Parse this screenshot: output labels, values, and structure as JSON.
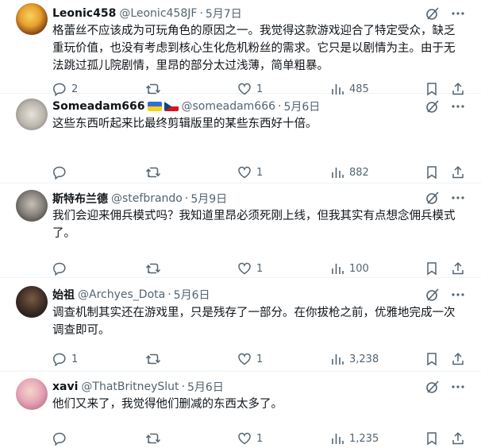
{
  "tweets": [
    {
      "display_name": "Leonic458",
      "handle": "@Leonic458JF",
      "time": "5月7日",
      "text": "格蕾丝不应该成为可玩角色的原因之一。我觉得这款游戏迎合了特定受众，缺乏重玩价值，也没有考虑到核心生化危机粉丝的需求。它只是以剧情为主。由于无法跳过孤儿院剧情，里昂的部分太过浅薄，简单粗暴。",
      "replies": "2",
      "retweets": "",
      "likes": "1",
      "views": "485"
    },
    {
      "display_name": "Someadam666",
      "handle": "@someadam666",
      "time": "5月6日",
      "text": "这些东西听起来比最终剪辑版里的某些东西好十倍。",
      "replies": "",
      "retweets": "",
      "likes": "1",
      "views": "882"
    },
    {
      "display_name": "斯特布兰德",
      "handle": "@stefbrando",
      "time": "5月9日",
      "text": "我们会迎来佣兵模式吗？我知道里昂必须死刚上线，但我其实有点想念佣兵模式了。",
      "replies": "",
      "retweets": "",
      "likes": "1",
      "views": "100"
    },
    {
      "display_name": "始祖",
      "handle": "@Archyes_Dota",
      "time": "5月6日",
      "text": "调查机制其实还在游戏里，只是残存了一部分。在你拔枪之前，优雅地完成一次调查即可。",
      "replies": "1",
      "retweets": "",
      "likes": "1",
      "views": "3,238"
    },
    {
      "display_name": "xavi",
      "handle": "@ThatBritneySlut",
      "time": "5月6日",
      "text": "他们又来了，我觉得他们删减的东西太多了。",
      "replies": "",
      "retweets": "",
      "likes": "1",
      "views": "1,235"
    }
  ],
  "meta": {
    "separator": "·"
  },
  "icons": {
    "reply": "reply-icon",
    "retweet": "retweet-icon",
    "like": "like-icon",
    "views": "views-icon",
    "bookmark": "bookmark-icon",
    "share": "share-icon",
    "grok": "grok-icon",
    "more": "more-icon"
  },
  "colors": {
    "text": "#0f1419",
    "muted": "#536471",
    "divider": "#eff3f4"
  }
}
